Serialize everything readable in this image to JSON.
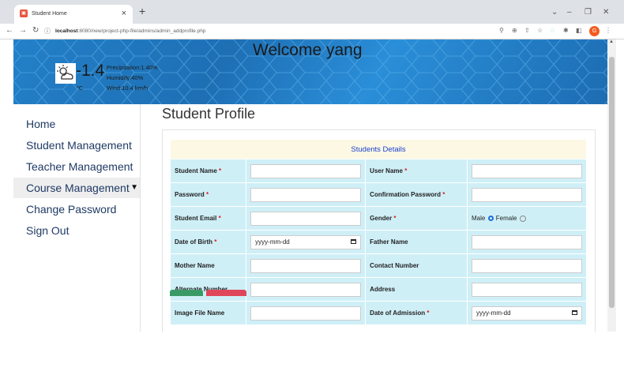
{
  "browser": {
    "tab_title": "Student Home",
    "tab_close": "×",
    "new_tab": "+",
    "window_controls": [
      "⌄",
      "–",
      "❐",
      "✕"
    ],
    "url_host": "localhost",
    "url_rest": ":8080/new/project-php-file/admins/admin_addprofile.php",
    "profile_initial": "G"
  },
  "banner": {
    "welcome": "Welcome yang",
    "temperature": "-1.4",
    "unit": "°C",
    "precipitation": "Precipitation:1.40%",
    "humidity": "Humidity:40%",
    "wind": "Wind:10.4 km/h"
  },
  "sidebar": {
    "items": [
      {
        "label": "Home"
      },
      {
        "label": "Student Management"
      },
      {
        "label": "Teacher Management"
      },
      {
        "label": "Course Management"
      },
      {
        "label": "Change Password"
      },
      {
        "label": "Sign Out"
      }
    ]
  },
  "page": {
    "title": "Student Profile"
  },
  "form": {
    "header": "Students Details",
    "required_mark": "*",
    "fields": {
      "student_name": "Student Name",
      "user_name": "User Name",
      "password": "Password",
      "confirmation_password": "Confirmation Password",
      "student_email": "Student Email",
      "gender": "Gender",
      "date_of_birth": "Date of Birth",
      "father_name": "Father Name",
      "mother_name": "Mother Name",
      "contact_number": "Contact Number",
      "alternate_number": "Alternate Number",
      "address": "Address",
      "image_file_name": "Image File Name",
      "date_of_admission": "Date of Admission"
    },
    "gender_options": {
      "male": "Male",
      "female": "Female",
      "selected": "Male"
    },
    "date_placeholder": "yyyy-mm-dd"
  }
}
